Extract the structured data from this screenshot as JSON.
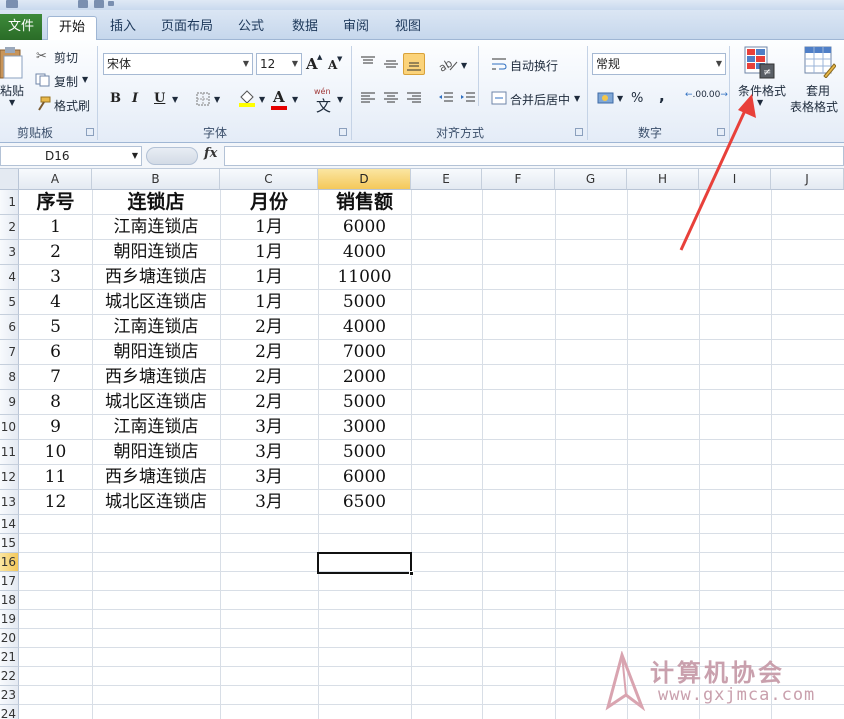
{
  "tabs": {
    "file": "文件",
    "items": [
      "开始",
      "插入",
      "页面布局",
      "公式",
      "数据",
      "审阅",
      "视图"
    ],
    "active": "开始"
  },
  "clipboard": {
    "paste": "粘贴",
    "cut": "剪切",
    "copy": "复制",
    "format_painter": "格式刷",
    "label": "剪贴板"
  },
  "font": {
    "name": "宋体",
    "size": "12",
    "bold": "B",
    "italic": "I",
    "underline": "U",
    "grow": "A",
    "shrink": "A",
    "wen": "wén",
    "wen_char": "文",
    "label": "字体"
  },
  "alignment": {
    "wrap": "自动换行",
    "merge": "合并后居中",
    "label": "对齐方式"
  },
  "number": {
    "format": "常规",
    "percent": "%",
    "comma": ",",
    "inc_decimal": ".00",
    "dec_decimal": ".00",
    "label": "数字"
  },
  "styles": {
    "conditional": "条件格式",
    "table_line1": "套用",
    "table_line2": "表格格式"
  },
  "formula_bar": {
    "name_box": "D16",
    "fx": "fx",
    "value": ""
  },
  "columns": [
    "A",
    "B",
    "C",
    "D",
    "E",
    "F",
    "G",
    "H",
    "I",
    "J"
  ],
  "rows": [
    "1",
    "2",
    "3",
    "4",
    "5",
    "6",
    "7",
    "8",
    "9",
    "10",
    "11",
    "12",
    "13",
    "14",
    "15",
    "16",
    "17",
    "18",
    "19",
    "20",
    "21",
    "22",
    "23",
    "24"
  ],
  "table": {
    "headers": [
      "序号",
      "连锁店",
      "月份",
      "销售额"
    ],
    "data": [
      [
        "1",
        "江南连锁店",
        "1月",
        "6000"
      ],
      [
        "2",
        "朝阳连锁店",
        "1月",
        "4000"
      ],
      [
        "3",
        "西乡塘连锁店",
        "1月",
        "11000"
      ],
      [
        "4",
        "城北区连锁店",
        "1月",
        "5000"
      ],
      [
        "5",
        "江南连锁店",
        "2月",
        "4000"
      ],
      [
        "6",
        "朝阳连锁店",
        "2月",
        "7000"
      ],
      [
        "7",
        "西乡塘连锁店",
        "2月",
        "2000"
      ],
      [
        "8",
        "城北区连锁店",
        "2月",
        "5000"
      ],
      [
        "9",
        "江南连锁店",
        "3月",
        "3000"
      ],
      [
        "10",
        "朝阳连锁店",
        "3月",
        "5000"
      ],
      [
        "11",
        "西乡塘连锁店",
        "3月",
        "6000"
      ],
      [
        "12",
        "城北区连锁店",
        "3月",
        "6500"
      ]
    ]
  },
  "selected_cell": "D16",
  "watermark": {
    "title": "计算机协会",
    "url": "www.gxjmca.com"
  },
  "colors": {
    "file_tab": "#2f7a2c",
    "selected_header": "#f4c85a",
    "annotation_arrow": "#e8403a",
    "watermark": "#c9a0ad"
  }
}
